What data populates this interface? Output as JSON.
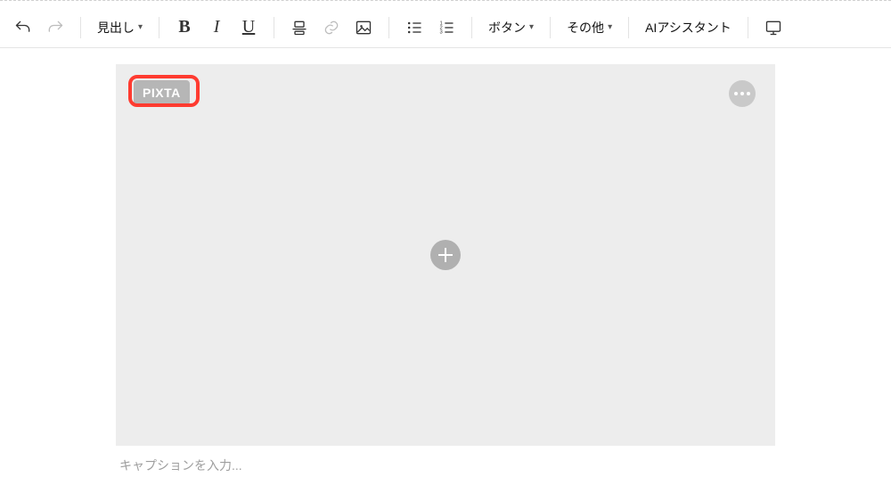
{
  "toolbar": {
    "heading_label": "見出し",
    "bold_label": "B",
    "italic_label": "I",
    "underline_label": "U",
    "button_label": "ボタン",
    "other_label": "その他",
    "ai_assistant_label": "AIアシスタント"
  },
  "canvas": {
    "tag_label": "PIXTA"
  },
  "caption": {
    "placeholder": "キャプションを入力..."
  }
}
